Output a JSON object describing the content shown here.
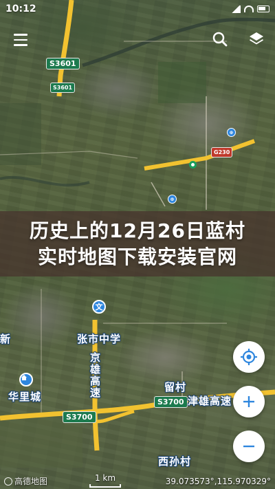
{
  "status_bar": {
    "time": "10:12"
  },
  "map": {
    "road_shields": [
      "S3601",
      "S3601",
      "G230",
      "S3700",
      "S3700"
    ],
    "poi_labels": {
      "zhangshi_middle_school": "张市中学",
      "jingxiong_expressway": "京雄高速",
      "huali_city": "华里城",
      "liucun": "留村",
      "jinxiong_expressway_east": "津雄高速",
      "xizhangcun": "西孙村",
      "edge_left_top": "新",
      "poi_tiny_1": "Ⓔ",
      "poi_tiny_2": "",
      "poi_tiny_3": ""
    },
    "colors": {
      "highway": "#f2c230",
      "road_shield": "#1c7a4e",
      "poi_pin": "#2e86de"
    }
  },
  "banner": {
    "line1": "历史上的12月26日蓝村",
    "line2": "实时地图下载安装官网"
  },
  "controls": {
    "menu_icon": "hamburger-icon",
    "search_icon": "search-icon",
    "layers_icon": "layers-icon",
    "locate_icon": "locate-icon",
    "zoom_in_icon": "plus-icon",
    "zoom_out_icon": "minus-icon"
  },
  "bottom_bar": {
    "provider": "高德地图",
    "scale_label": "1 km",
    "coordinates": "39.073573°,115.970329°"
  }
}
